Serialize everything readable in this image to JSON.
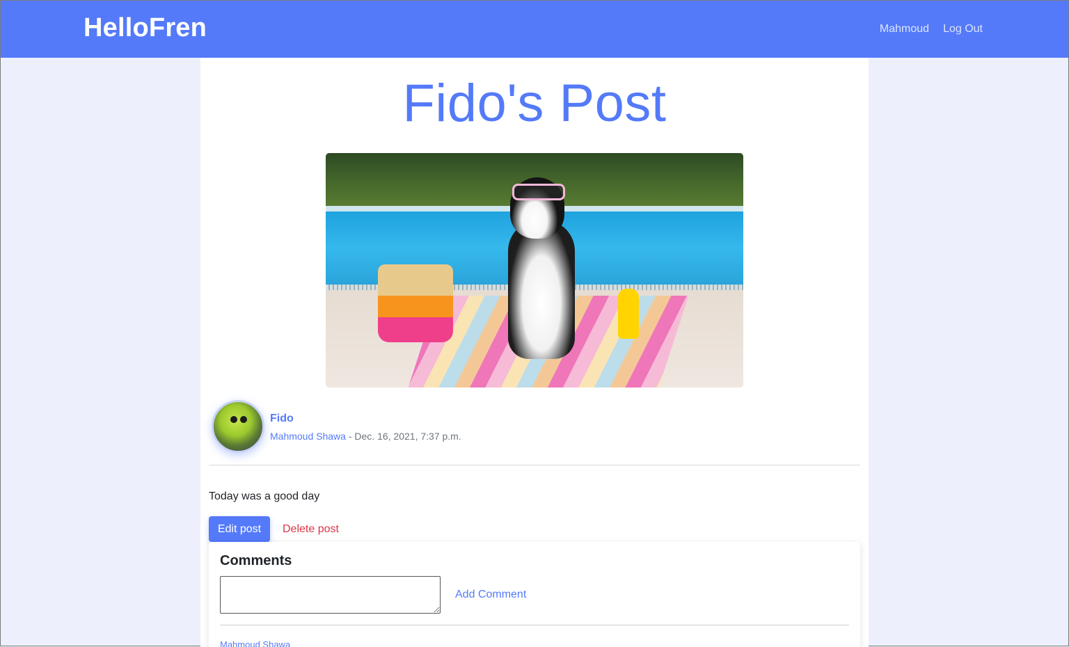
{
  "navbar": {
    "brand": "HelloFren",
    "links": [
      {
        "label": "Mahmoud"
      },
      {
        "label": "Log Out"
      }
    ]
  },
  "post": {
    "title": "Fido's Post",
    "image_alt": "dog-in-sunglasses-by-pool",
    "pet_name": "Fido",
    "owner_name": "Mahmoud Shawa",
    "date_separator": " - ",
    "date": "Dec. 16, 2021, 7:37 p.m.",
    "body": "Today was a good day",
    "edit_label": "Edit post",
    "delete_label": "Delete post"
  },
  "comments": {
    "title": "Comments",
    "input_value": "",
    "add_label": "Add Comment",
    "items": [
      {
        "author": "Mahmoud Shawa"
      }
    ]
  },
  "colors": {
    "primary": "#547af9",
    "page_bg": "#edf0fc",
    "danger": "#dc3545"
  }
}
